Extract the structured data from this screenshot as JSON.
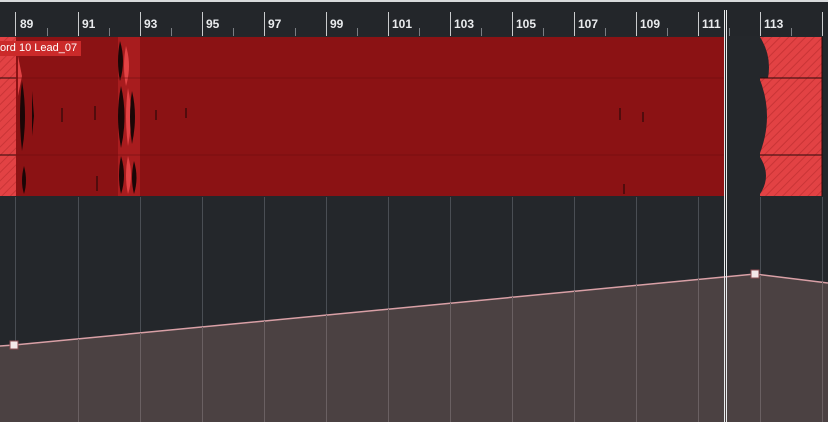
{
  "ruler": {
    "bars": [
      "89",
      "91",
      "93",
      "95",
      "97",
      "99",
      "101",
      "103",
      "105",
      "107",
      "109",
      "111",
      "113"
    ]
  },
  "event": {
    "name": "ord 10 Lead_07",
    "color": "#8b1214",
    "selected_color": "#e24244"
  },
  "automation": {
    "line_color": "#d9a0a6",
    "fill_color": "#4b4142",
    "points_label": "volume automation"
  },
  "colors": {
    "background": "#24272b",
    "cursor": "#e8eaec"
  }
}
